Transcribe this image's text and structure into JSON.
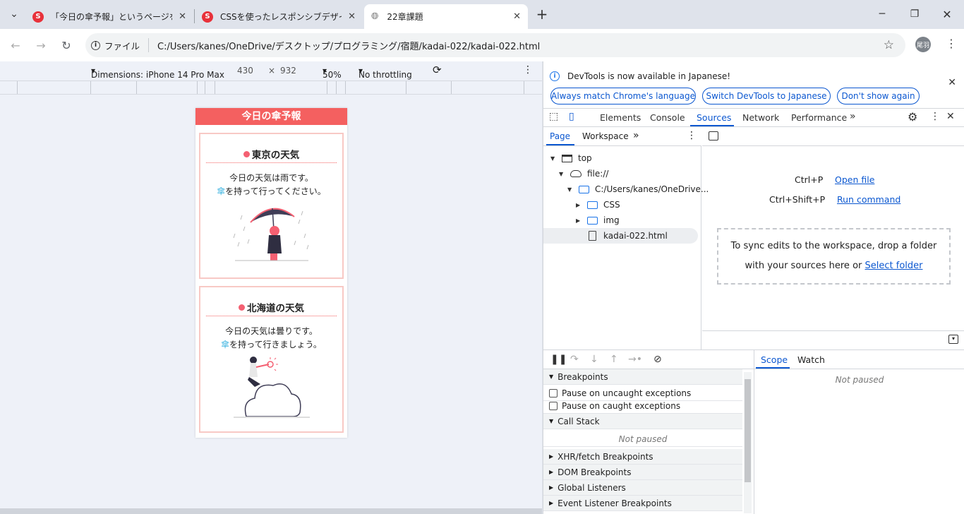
{
  "browser": {
    "tabs": [
      {
        "title": "「今日の傘予報」というページを作成",
        "favicon": "S"
      },
      {
        "title": "CSSを使ったレスポンシブデザインを理",
        "favicon": "S"
      },
      {
        "title": "22章課題"
      }
    ],
    "new_tab": "+",
    "address": {
      "chip": "ファイル",
      "url": "C:/Users/kanes/OneDrive/デスクトップ/プログラミング/宿題/kadai-022/kadai-022.html"
    },
    "profile": "尾羽"
  },
  "device_toolbar": {
    "dimensions": "Dimensions: iPhone 14 Pro Max",
    "width": "430",
    "times": "×",
    "height": "932",
    "zoom": "50%",
    "throttling": "No throttling"
  },
  "page": {
    "header": "今日の傘予報",
    "cards": [
      {
        "title": "東京の天気",
        "line1": "今日の天気は雨です。",
        "umbrella": "傘",
        "line2": "を持って行ってください。"
      },
      {
        "title": "北海道の天気",
        "line1": "今日の天気は曇りです。",
        "umbrella": "傘",
        "line2": "を持って行きましょう。"
      }
    ]
  },
  "devtools": {
    "infobar": {
      "message": "DevTools is now available in Japanese!",
      "btn1": "Always match Chrome's language",
      "btn2": "Switch DevTools to Japanese",
      "btn3": "Don't show again"
    },
    "tabs": [
      "Elements",
      "Console",
      "Sources",
      "Network",
      "Performance"
    ],
    "subtabs": [
      "Page",
      "Workspace"
    ],
    "tree": {
      "top": "top",
      "origin": "file://",
      "folder": "C:/Users/kanes/OneDrive...",
      "css": "CSS",
      "img": "img",
      "file": "kadai-022.html"
    },
    "editor": {
      "shortcut1": "Ctrl+P",
      "action1": "Open file",
      "shortcut2": "Ctrl+Shift+P",
      "action2": "Run command",
      "drop_text1": "To sync edits to the workspace, drop a folder",
      "drop_text2": "with your sources here or",
      "drop_link": "Select folder"
    },
    "debugger": {
      "breakpoints": "Breakpoints",
      "pause_uncaught": "Pause on uncaught exceptions",
      "pause_caught": "Pause on caught exceptions",
      "call_stack": "Call Stack",
      "not_paused": "Not paused",
      "xhr": "XHR/fetch Breakpoints",
      "dom": "DOM Breakpoints",
      "global": "Global Listeners",
      "event": "Event Listener Breakpoints"
    },
    "scope_tabs": [
      "Scope",
      "Watch"
    ],
    "scope_text": "Not paused"
  }
}
